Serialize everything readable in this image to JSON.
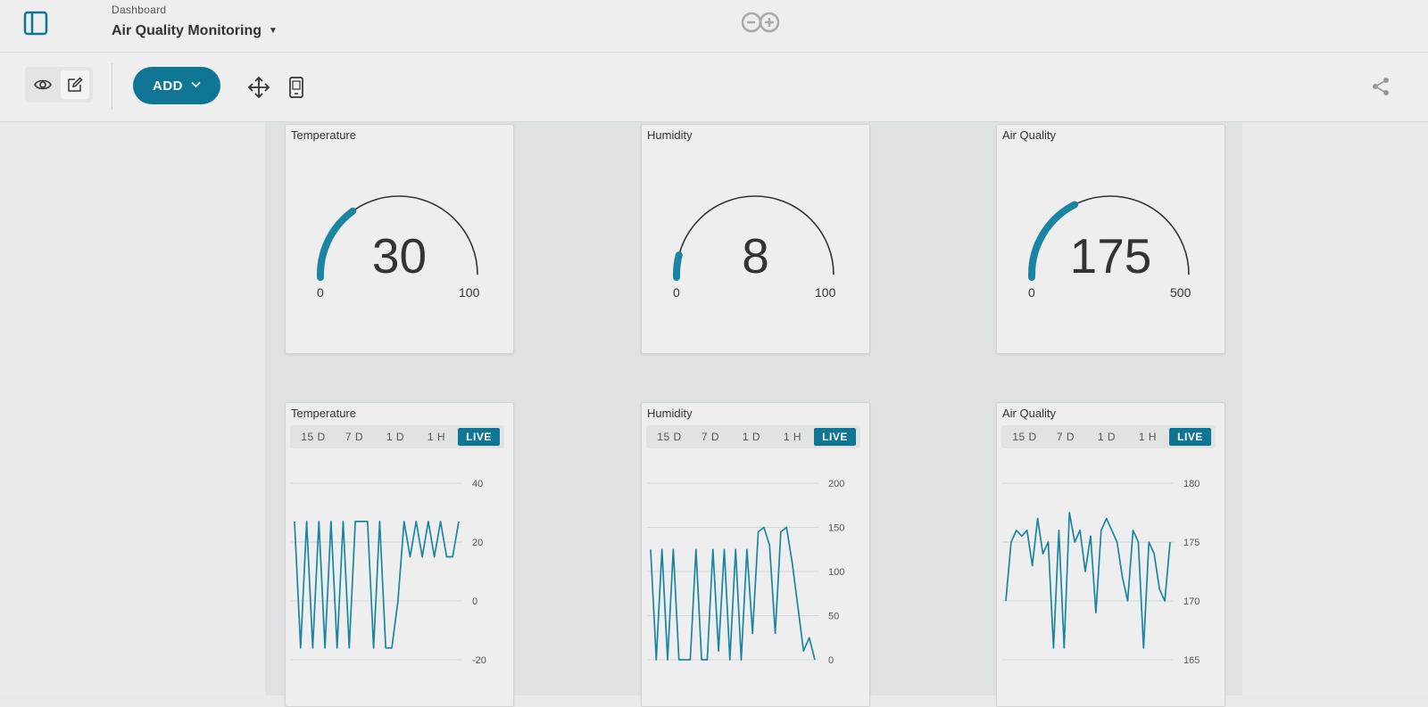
{
  "header": {
    "breadcrumb": "Dashboard",
    "dashboard_name": "Air Quality Monitoring"
  },
  "toolbar": {
    "add_label": "ADD",
    "icons": [
      "eye-icon",
      "pencil-icon",
      "move-icon",
      "mobile-icon",
      "share-icon"
    ]
  },
  "colors": {
    "accent": "#0f7595",
    "gauge_track": "#333333",
    "line": "#1a85a3"
  },
  "gauges": [
    {
      "title": "Temperature",
      "value": "30",
      "min": "0",
      "max": "100",
      "fraction": 0.3
    },
    {
      "title": "Humidity",
      "value": "8",
      "min": "0",
      "max": "100",
      "fraction": 0.08
    },
    {
      "title": "Air Quality",
      "value": "175",
      "min": "0",
      "max": "500",
      "fraction": 0.35
    }
  ],
  "range_options": [
    "15 D",
    "7 D",
    "1 D",
    "1 H",
    "LIVE"
  ],
  "active_range": "LIVE",
  "chart_data": [
    {
      "type": "line",
      "title": "Temperature",
      "yticks": [
        "40",
        "20",
        "0",
        "-20"
      ],
      "ylim": [
        -20,
        40
      ],
      "values": [
        27,
        -16,
        27,
        -16,
        27,
        -16,
        27,
        -16,
        27,
        -16,
        27,
        27,
        27,
        -16,
        27,
        -16,
        -16,
        0,
        27,
        15,
        27,
        15,
        27,
        15,
        27,
        15,
        15,
        27
      ]
    },
    {
      "type": "line",
      "title": "Humidity",
      "yticks": [
        "200",
        "150",
        "100",
        "50",
        "0"
      ],
      "ylim": [
        0,
        200
      ],
      "values": [
        125,
        0,
        125,
        0,
        125,
        0,
        0,
        0,
        125,
        0,
        0,
        125,
        10,
        125,
        0,
        125,
        0,
        125,
        30,
        145,
        150,
        130,
        30,
        145,
        150,
        110,
        60,
        10,
        25,
        0
      ]
    },
    {
      "type": "line",
      "title": "Air Quality",
      "yticks": [
        "180",
        "175",
        "170",
        "165"
      ],
      "ylim": [
        165,
        180
      ],
      "values": [
        170,
        175,
        176,
        175.5,
        176,
        173,
        177,
        174,
        175,
        166,
        176,
        166,
        177.5,
        175,
        176,
        172.5,
        175.5,
        169,
        176,
        177,
        176,
        175,
        172,
        170,
        176,
        175,
        166,
        175,
        174,
        171,
        170,
        175
      ]
    }
  ]
}
